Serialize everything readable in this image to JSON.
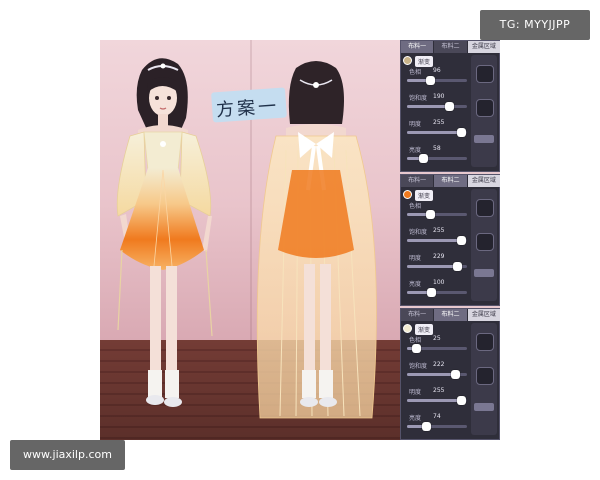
{
  "watermarks": {
    "top_right": "TG: MYYJJPP",
    "bottom_left": "www.jiaxilp.com"
  },
  "title_label": "方案一",
  "panels": [
    {
      "tabs": [
        "布料一",
        "布料二",
        "金属区域"
      ],
      "active_tab": 0,
      "subtabs": [
        "",
        "渐变"
      ],
      "sliders": [
        {
          "label": "色相",
          "value": "96",
          "level": 0.38
        },
        {
          "label": "饱和度",
          "value": "190",
          "level": 0.75
        },
        {
          "label": "明度",
          "value": "255",
          "level": 0.98
        },
        {
          "label": "亮度",
          "value": "58",
          "level": 0.23
        }
      ]
    },
    {
      "tabs": [
        "布料一",
        "布料二",
        "金属区域"
      ],
      "active_tab": 1,
      "subtabs": [
        "",
        "渐变"
      ],
      "sliders": [
        {
          "label": "色相",
          "value": "",
          "level": 0.38
        },
        {
          "label": "饱和度",
          "value": "255",
          "level": 0.98
        },
        {
          "label": "明度",
          "value": "229",
          "level": 0.9
        },
        {
          "label": "亮度",
          "value": "100",
          "level": 0.4
        }
      ]
    },
    {
      "tabs": [
        "布料一",
        "布料二",
        "金属区域"
      ],
      "active_tab": 1,
      "subtabs": [
        "",
        "渐变"
      ],
      "sliders": [
        {
          "label": "色相",
          "value": "25",
          "level": 0.1
        },
        {
          "label": "饱和度",
          "value": "222",
          "level": 0.87
        },
        {
          "label": "明度",
          "value": "255",
          "level": 0.98
        },
        {
          "label": "亮度",
          "value": "74",
          "level": 0.29
        }
      ]
    }
  ],
  "colors": {
    "dress_orange": "#f07a1e",
    "dress_cream": "#f3ecd2",
    "wall_pink": "#ebc8ce",
    "floor_wood": "#7a3f38",
    "panel_bg": "#2f2e3a"
  }
}
